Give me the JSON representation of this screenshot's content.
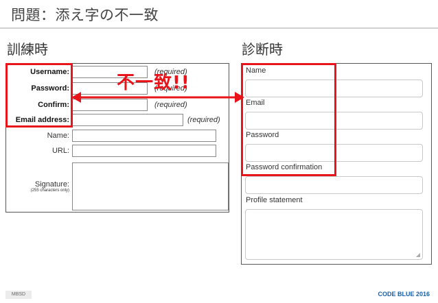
{
  "slide": {
    "title": "問題：添え字の不一致",
    "left_heading": "訓練時",
    "right_heading": "診断時",
    "mismatch_label": "不一致!!"
  },
  "left_form": {
    "rows": [
      {
        "label": "Username:",
        "required": "(required)"
      },
      {
        "label": "Password:",
        "required": "(required)"
      },
      {
        "label": "Confirm:",
        "required": "(required)"
      },
      {
        "label": "Email address:",
        "required": "(required)"
      },
      {
        "label": "Name:"
      },
      {
        "label": "URL:"
      }
    ],
    "signature_label": "Signature:",
    "signature_note": "(255 characters only)"
  },
  "right_form": {
    "fields": [
      "Name",
      "Email",
      "Password",
      "Password confirmation",
      "Profile statement"
    ]
  },
  "footer": {
    "left_badge": "MBSD",
    "right_text": "CODE BLUE 2016"
  },
  "colors": {
    "accent_red": "#e8141a",
    "footer_blue": "#1a5fa8"
  }
}
